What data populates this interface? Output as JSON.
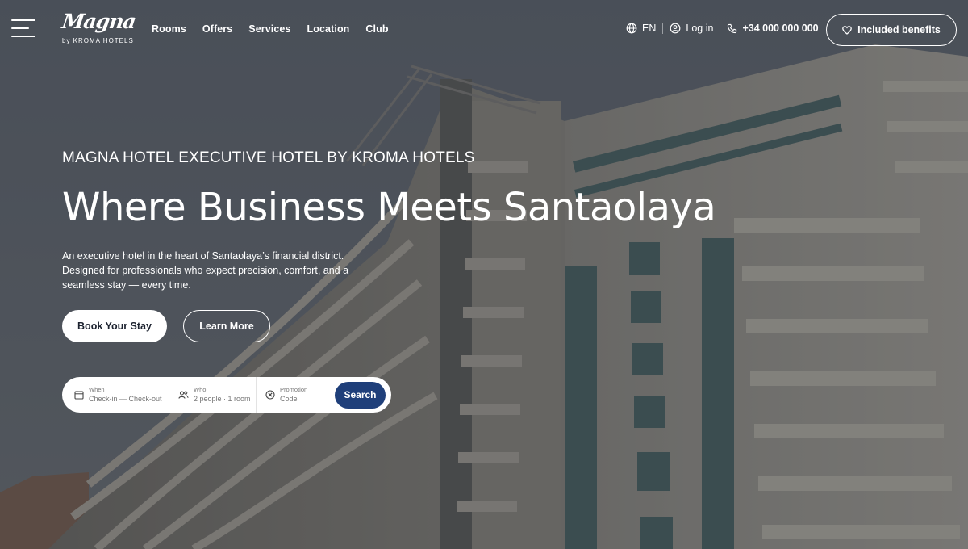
{
  "brand": {
    "logo_text": "Magna",
    "logo_sub": "by KROMA HOTELS"
  },
  "nav": {
    "items": [
      {
        "label": "Rooms"
      },
      {
        "label": "Offers"
      },
      {
        "label": "Services"
      },
      {
        "label": "Location"
      },
      {
        "label": "Club"
      }
    ]
  },
  "utility": {
    "language": "EN",
    "login": "Log in",
    "phone": "+34 000 000 000",
    "benefits_label": "Included benefits"
  },
  "hero": {
    "eyebrow": "MAGNA HOTEL EXECUTIVE HOTEL BY KROMA HOTELS",
    "headline": "Where Business Meets Santaolaya",
    "lead": "An executive hotel in the heart of Santaolaya’s financial district. Designed for professionals who expect precision, comfort, and a seamless stay — every time.",
    "primary_cta": "Book Your Stay",
    "secondary_cta": "Learn More"
  },
  "booking": {
    "when_label": "When",
    "when_value": "Check-in — Check-out",
    "who_label": "Who",
    "who_value": "2 people · 1 room",
    "promo_label": "Promotion",
    "promo_value": "Code",
    "search_label": "Search"
  },
  "icons": {
    "menu": "hamburger-icon",
    "language": "globe-icon",
    "login": "user-icon",
    "phone": "phone-icon",
    "benefits": "heart-icon",
    "when": "calendar-icon",
    "who": "people-icon",
    "promo": "tag-icon"
  },
  "colors": {
    "accent": "#1f3f7a",
    "overlay": "#4e5560"
  }
}
